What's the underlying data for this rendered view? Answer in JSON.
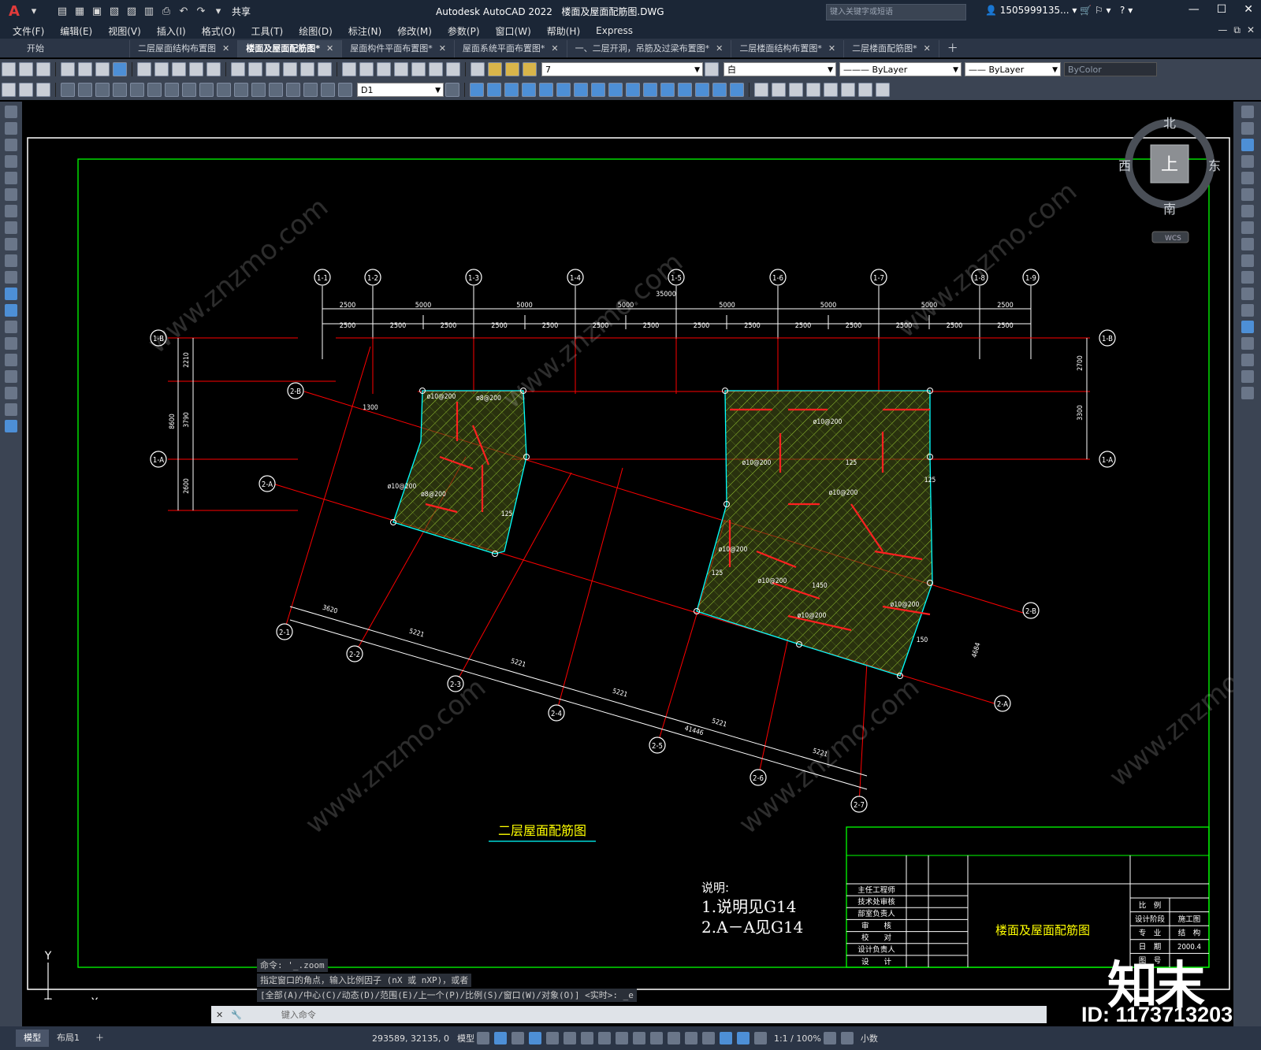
{
  "app": {
    "logo": "A",
    "title": "Autodesk AutoCAD 2022",
    "file": "楼面及屋面配筋图.DWG",
    "share": "共享",
    "search_placeholder": "键入关键字或短语",
    "user": "1505999135..."
  },
  "menu": [
    "文件(F)",
    "编辑(E)",
    "视图(V)",
    "插入(I)",
    "格式(O)",
    "工具(T)",
    "绘图(D)",
    "标注(N)",
    "修改(M)",
    "参数(P)",
    "窗口(W)",
    "帮助(H)",
    "Express"
  ],
  "tabs": [
    {
      "label": "开始",
      "closable": false,
      "active": false
    },
    {
      "label": "二层屋面结构布置图",
      "closable": true,
      "active": false
    },
    {
      "label": "楼面及屋面配筋图*",
      "closable": true,
      "active": true
    },
    {
      "label": "屋面构件平面布置图*",
      "closable": true,
      "active": false
    },
    {
      "label": "屋面系统平面布置图*",
      "closable": true,
      "active": false
    },
    {
      "label": "一、二层开洞，吊筋及过梁布置图*",
      "closable": true,
      "active": false
    },
    {
      "label": "二层楼面结构布置图*",
      "closable": true,
      "active": false
    },
    {
      "label": "二层楼面配筋图*",
      "closable": true,
      "active": false
    }
  ],
  "toolbar": {
    "layer_value": "7",
    "color_value": "白",
    "linetype_value": "ByLayer",
    "lineweight_value": "ByLayer",
    "plotstyle_value": "ByColor",
    "dimstyle_value": "D1"
  },
  "viewcube": {
    "north": "北",
    "south": "南",
    "east": "东",
    "west": "西",
    "face": "上",
    "wcs": "WCS"
  },
  "drawing": {
    "top_axes": [
      "1-1",
      "1-2",
      "1-3",
      "1-4",
      "1-5",
      "1-6",
      "1-7",
      "1-8",
      "1-9"
    ],
    "top_dims_total": "35000",
    "top_dims_row1": [
      "2500",
      "5000",
      "5000",
      "5000",
      "5000",
      "5000",
      "5000",
      "2500"
    ],
    "top_dims_row2": [
      "2500",
      "2500",
      "2500",
      "2500",
      "2500",
      "2500",
      "2500",
      "2500",
      "2500",
      "2500",
      "2500",
      "2500",
      "2500",
      "2500"
    ],
    "left_axes": [
      "1-B",
      "1-A"
    ],
    "right_axes": [
      "1-B",
      "1-A"
    ],
    "left_dims": [
      "2210",
      "3790",
      "2600",
      "8600"
    ],
    "right_dims": [
      "2700",
      "3300"
    ],
    "slanted_axes": [
      "2-1",
      "2-2",
      "2-3",
      "2-4",
      "2-5",
      "2-6",
      "2-7"
    ],
    "slanted_row_axes": [
      "2-B",
      "2-A"
    ],
    "bottom_dims": [
      "3620",
      "5221",
      "5221",
      "5221",
      "5221",
      "5221",
      "41446"
    ],
    "right_slanted_dim": "4684",
    "rebar_labels": [
      "ø10@200",
      "ø8@200",
      "125",
      "1450",
      "1300",
      "150"
    ],
    "plan_title": "二层屋面配筋图",
    "notes_title": "说明:",
    "notes": [
      "1.说明见G14",
      "2.A－A见G14"
    ],
    "titleblock": {
      "roles": [
        "主任工程师",
        "技术处审核",
        "部室负责人",
        "审　　核",
        "校　　对",
        "设计负责人",
        "设　　计"
      ],
      "drawing_name": "楼面及屋面配筋图",
      "fields": [
        {
          "label": "比　例",
          "value": ""
        },
        {
          "label": "设计阶段",
          "value": "施工图"
        },
        {
          "label": "专　业",
          "value": "结　构"
        },
        {
          "label": "日　期",
          "value": "2000.4"
        },
        {
          "label": "图　号",
          "value": ""
        }
      ]
    },
    "ucs": {
      "y": "Y",
      "x": "X"
    }
  },
  "command": {
    "history": [
      "命令: '_.zoom",
      "指定窗口的角点，输入比例因子 (nX 或 nXP)，或者",
      "[全部(A)/中心(C)/动态(D)/范围(E)/上一个(P)/比例(S)/窗口(W)/对象(O)] <实时>: _e"
    ],
    "placeholder": "键入命令"
  },
  "status": {
    "tabs": [
      "模型",
      "布局1"
    ],
    "coords": "293589, 32135, 0",
    "model_label": "模型",
    "scale": "1:1 / 100%",
    "units": "小数"
  },
  "watermark": {
    "brand": "知末",
    "id": "ID: 1173713203",
    "site": "www.znzmo.com"
  },
  "colors": {
    "frame": "#00ff00",
    "axis": "#ff0000",
    "dim": "#ffffff",
    "hatch": "#9acd32",
    "title": "#ffff00",
    "edge": "#00ffff"
  }
}
